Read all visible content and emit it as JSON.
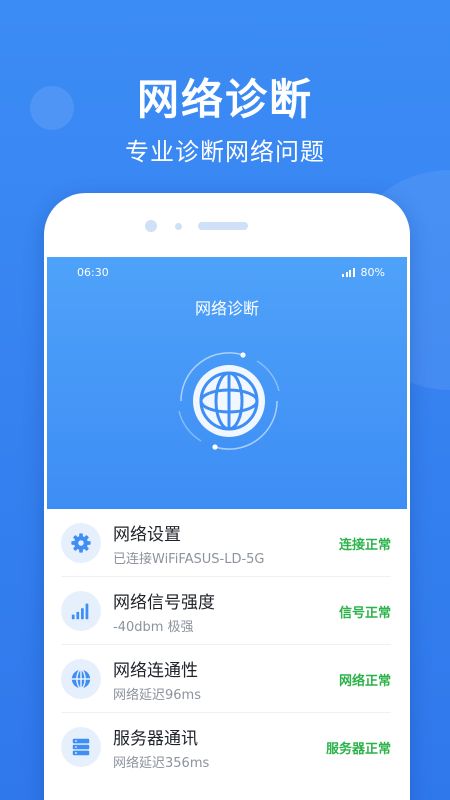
{
  "promo": {
    "title": "网络诊断",
    "subtitle": "专业诊断网络问题"
  },
  "status_bar": {
    "time": "06:30",
    "battery": "80%"
  },
  "screen": {
    "title": "网络诊断"
  },
  "items": [
    {
      "title": "网络设置",
      "subtitle": "已连接WiFiFASUS-LD-5G",
      "status": "连接正常",
      "icon": "gear-icon"
    },
    {
      "title": "网络信号强度",
      "subtitle": "-40dbm 极强",
      "status": "信号正常",
      "icon": "signal-bars-icon"
    },
    {
      "title": "网络连通性",
      "subtitle": "网络延迟96ms",
      "status": "网络正常",
      "icon": "globe-icon"
    },
    {
      "title": "服务器通讯",
      "subtitle": "网络延迟356ms",
      "status": "服务器正常",
      "icon": "server-icon"
    }
  ],
  "colors": {
    "brand_blue": "#3c8cf5",
    "status_green": "#2bb34a",
    "icon_blue": "#3f8ef5"
  }
}
